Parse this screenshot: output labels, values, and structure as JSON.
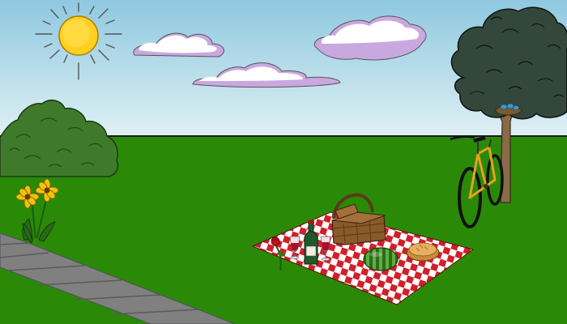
{
  "scene": {
    "colors": {
      "sky_top": "#8fc8e0",
      "sky_bottom": "#dff0f4",
      "grass": "#2a8a07",
      "horizon_line": "#1a1a1a",
      "path": "#808080",
      "blanket_red": "#d0202a",
      "blanket_white": "#ffffff",
      "basket": "#8a5a2b",
      "sun": "#ffd020",
      "cloud_shadow": "#c9a8e0",
      "bicycle_frame": "#e8a020",
      "tree_foliage": "#33483a",
      "bush": "#3f7a2a",
      "wine_bottle": "#1f5a2a",
      "watermelon": "#2f7a2a",
      "pie": "#e6b060",
      "rose": "#c01020",
      "flower_petals": "#f2c20a",
      "bird_nest_eggs": "#3a9ad0"
    },
    "items": [
      "sun-icon",
      "cloud-icon",
      "tree-icon",
      "bird-nest-icon",
      "bicycle-icon",
      "bush-icon",
      "flower-icon",
      "stone-path",
      "picnic-blanket",
      "picnic-basket-icon",
      "wine-bottle-icon",
      "wine-glass-icon",
      "rose-icon",
      "watermelon-icon",
      "pie-icon"
    ]
  }
}
